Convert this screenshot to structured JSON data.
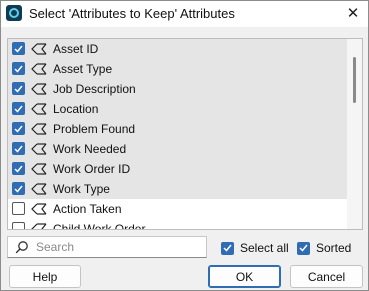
{
  "window": {
    "title": "Select 'Attributes to Keep' Attributes",
    "close_glyph": "✕"
  },
  "attributes": [
    {
      "label": "Asset ID",
      "checked": true
    },
    {
      "label": "Asset Type",
      "checked": true
    },
    {
      "label": "Job Description",
      "checked": true
    },
    {
      "label": "Location",
      "checked": true
    },
    {
      "label": "Problem Found",
      "checked": true
    },
    {
      "label": "Work Needed",
      "checked": true
    },
    {
      "label": "Work Order ID",
      "checked": true
    },
    {
      "label": "Work Type",
      "checked": true
    },
    {
      "label": "Action Taken",
      "checked": false
    },
    {
      "label": "Child Work Order",
      "checked": false
    }
  ],
  "search": {
    "placeholder": "Search",
    "value": ""
  },
  "options": {
    "select_all_label": "Select all",
    "select_all_checked": true,
    "sorted_label": "Sorted",
    "sorted_checked": true
  },
  "buttons": {
    "help_label": "Help",
    "ok_label": "OK",
    "cancel_label": "Cancel"
  },
  "colors": {
    "accent": "#2f6cb4",
    "selected_row": "#e5e5e5",
    "dialog_bg": "#f0f0f0",
    "app_icon": "#0f3b55",
    "app_icon_ring": "#5fd0e6"
  }
}
